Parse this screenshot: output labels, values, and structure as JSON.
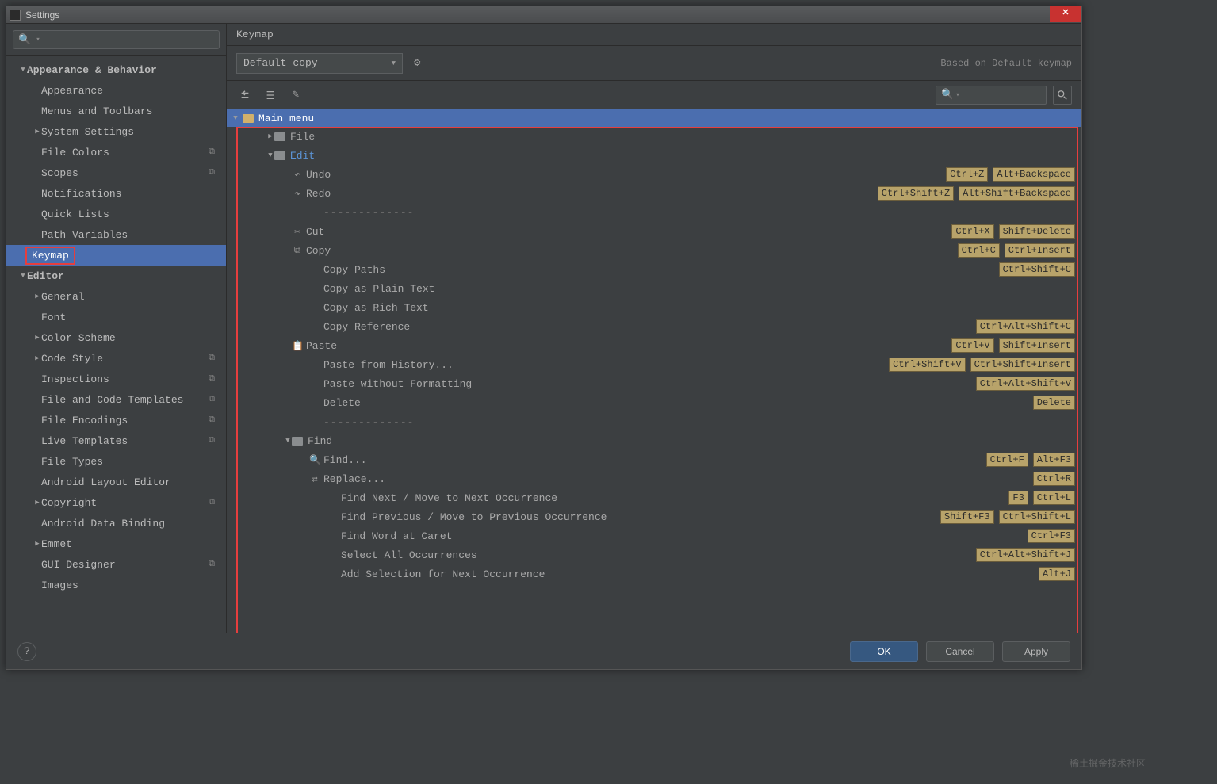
{
  "window": {
    "title": "Settings"
  },
  "sidebar": {
    "search_placeholder": "",
    "items": [
      {
        "label": "Appearance & Behavior",
        "depth": 0,
        "expand": "down",
        "bold": true
      },
      {
        "label": "Appearance",
        "depth": 1
      },
      {
        "label": "Menus and Toolbars",
        "depth": 1
      },
      {
        "label": "System Settings",
        "depth": 1,
        "expand": "right"
      },
      {
        "label": "File Colors",
        "depth": 1,
        "copyind": true
      },
      {
        "label": "Scopes",
        "depth": 1,
        "copyind": true
      },
      {
        "label": "Notifications",
        "depth": 1
      },
      {
        "label": "Quick Lists",
        "depth": 1
      },
      {
        "label": "Path Variables",
        "depth": 1
      },
      {
        "label": "Keymap",
        "depth": 0,
        "selected": true,
        "redbox": true,
        "bold": true
      },
      {
        "label": "Editor",
        "depth": 0,
        "expand": "down",
        "bold": true
      },
      {
        "label": "General",
        "depth": 1,
        "expand": "right"
      },
      {
        "label": "Font",
        "depth": 1
      },
      {
        "label": "Color Scheme",
        "depth": 1,
        "expand": "right"
      },
      {
        "label": "Code Style",
        "depth": 1,
        "expand": "right",
        "copyind": true
      },
      {
        "label": "Inspections",
        "depth": 1,
        "copyind": true
      },
      {
        "label": "File and Code Templates",
        "depth": 1,
        "copyind": true
      },
      {
        "label": "File Encodings",
        "depth": 1,
        "copyind": true
      },
      {
        "label": "Live Templates",
        "depth": 1,
        "copyind": true
      },
      {
        "label": "File Types",
        "depth": 1
      },
      {
        "label": "Android Layout Editor",
        "depth": 1
      },
      {
        "label": "Copyright",
        "depth": 1,
        "expand": "right",
        "copyind": true
      },
      {
        "label": "Android Data Binding",
        "depth": 1
      },
      {
        "label": "Emmet",
        "depth": 1,
        "expand": "right"
      },
      {
        "label": "GUI Designer",
        "depth": 1,
        "copyind": true
      },
      {
        "label": "Images",
        "depth": 1
      }
    ]
  },
  "main": {
    "title": "Keymap",
    "scheme": "Default copy",
    "based_on": "Based on Default keymap",
    "root": "Main menu",
    "rows": [
      {
        "depth": 1,
        "chev": "right",
        "folder": true,
        "label": "File"
      },
      {
        "depth": 1,
        "chev": "down",
        "folder": true,
        "label": "Edit",
        "blue": true
      },
      {
        "depth": 2,
        "icon": "undo",
        "label": "Undo",
        "sc": [
          "Ctrl+Z",
          "Alt+Backspace"
        ]
      },
      {
        "depth": 2,
        "icon": "redo",
        "label": "Redo",
        "sc": [
          "Ctrl+Shift+Z",
          "Alt+Shift+Backspace"
        ]
      },
      {
        "depth": 2,
        "sep": true
      },
      {
        "depth": 2,
        "icon": "cut",
        "label": "Cut",
        "sc": [
          "Ctrl+X",
          "Shift+Delete"
        ]
      },
      {
        "depth": 2,
        "icon": "copy",
        "label": "Copy",
        "sc": [
          "Ctrl+C",
          "Ctrl+Insert"
        ]
      },
      {
        "depth": 3,
        "label": "Copy Paths",
        "sc": [
          "Ctrl+Shift+C"
        ]
      },
      {
        "depth": 3,
        "label": "Copy as Plain Text"
      },
      {
        "depth": 3,
        "label": "Copy as Rich Text"
      },
      {
        "depth": 3,
        "label": "Copy Reference",
        "sc": [
          "Ctrl+Alt+Shift+C"
        ]
      },
      {
        "depth": 2,
        "icon": "paste",
        "label": "Paste",
        "sc": [
          "Ctrl+V",
          "Shift+Insert"
        ]
      },
      {
        "depth": 3,
        "label": "Paste from History...",
        "sc": [
          "Ctrl+Shift+V",
          "Ctrl+Shift+Insert"
        ]
      },
      {
        "depth": 3,
        "label": "Paste without Formatting",
        "sc": [
          "Ctrl+Alt+Shift+V"
        ]
      },
      {
        "depth": 3,
        "label": "Delete",
        "sc": [
          "Delete"
        ]
      },
      {
        "depth": 2,
        "sep": true
      },
      {
        "depth": 2,
        "chev": "down",
        "folder": true,
        "label": "Find"
      },
      {
        "depth": 3,
        "icon": "find",
        "label": "Find...",
        "sc": [
          "Ctrl+F",
          "Alt+F3"
        ]
      },
      {
        "depth": 3,
        "icon": "replace",
        "label": "Replace...",
        "sc": [
          "Ctrl+R"
        ]
      },
      {
        "depth": 4,
        "label": "Find Next / Move to Next Occurrence",
        "sc": [
          "F3",
          "Ctrl+L"
        ]
      },
      {
        "depth": 4,
        "label": "Find Previous / Move to Previous Occurrence",
        "sc": [
          "Shift+F3",
          "Ctrl+Shift+L"
        ]
      },
      {
        "depth": 4,
        "label": "Find Word at Caret",
        "sc": [
          "Ctrl+F3"
        ]
      },
      {
        "depth": 4,
        "label": "Select All Occurrences",
        "sc": [
          "Ctrl+Alt+Shift+J"
        ]
      },
      {
        "depth": 4,
        "label": "Add Selection for Next Occurrence",
        "sc": [
          "Alt+J"
        ]
      }
    ]
  },
  "footer": {
    "ok": "OK",
    "cancel": "Cancel",
    "apply": "Apply"
  },
  "watermark": "稀土掘金技术社区"
}
